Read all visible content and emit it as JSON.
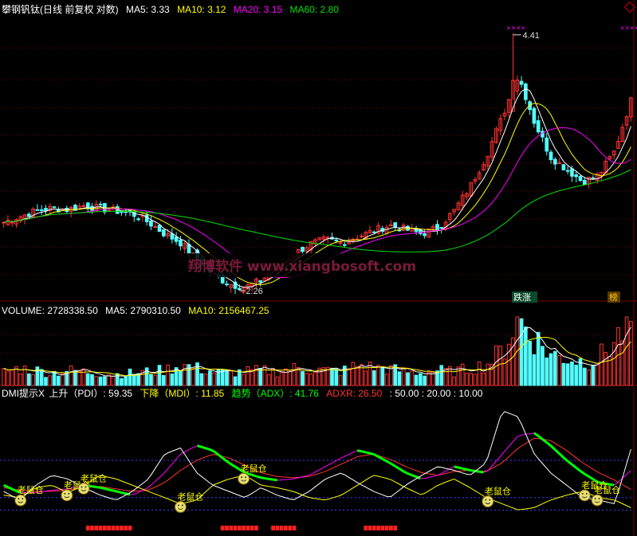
{
  "header": {
    "title": "攀钢钒钛(日线 前复权 对数)",
    "ma5": "MA5: 3.33",
    "ma10": "MA10: 3.12",
    "ma20": "MA20: 3.15",
    "ma60": "MA60: 2.80"
  },
  "volume_header": {
    "vol": "VOLUME: 2728338.50",
    "ma5": "MA5: 2790310.50",
    "ma10": "MA10: 2156467.25"
  },
  "dmi_header": {
    "name": "DMI提示X",
    "pdi": "上升（PDI）: 59.35",
    "mdi": "下降（MDI）: 11.85",
    "adx": "趋势（ADX）: 41.76",
    "adxr": "ADXR: 26.50",
    "levels": ": 50.00 : 20.00 : 10.00"
  },
  "annotations": {
    "high_label": "4.41",
    "low_label": "2.26",
    "tag_diezhang": "跌涨",
    "tag_bang": "榜",
    "watermark": "翔博软件 www.xiangbosoft.com",
    "mouse_label": "老鼠仓"
  },
  "colors": {
    "up": "#ff3232",
    "down": "#54fcfc",
    "ma5": "#ffffff",
    "ma10": "#ffff00",
    "ma20": "#ff00ff",
    "ma60": "#00e000",
    "pdi": "#ffffff",
    "mdi": "#ffff00",
    "adx_hi": "#00ff00",
    "adx_lo": "#ff00ff",
    "adxr": "#ff3232",
    "grid": "#7a0000"
  },
  "chart_data": {
    "type": "candlestick",
    "price_scale": "log",
    "ylim": [
      2.2,
      4.5
    ],
    "high": 4.41,
    "low": 2.26,
    "price_trend": [
      2.7,
      2.74,
      2.78,
      2.8,
      2.79,
      2.82,
      2.8,
      2.78,
      2.76,
      2.7,
      2.62,
      2.56,
      2.45,
      2.36,
      2.3,
      2.28,
      2.32,
      2.4,
      2.48,
      2.55,
      2.58,
      2.56,
      2.6,
      2.64,
      2.68,
      2.65,
      2.62,
      2.66,
      2.78,
      2.96,
      3.2,
      3.55,
      3.95,
      3.5,
      3.2,
      3.1,
      3.0,
      3.05,
      3.25,
      3.7
    ],
    "volume_trend": [
      0.2,
      0.25,
      0.22,
      0.18,
      0.22,
      0.2,
      0.18,
      0.16,
      0.18,
      0.2,
      0.22,
      0.3,
      0.25,
      0.2,
      0.18,
      0.2,
      0.22,
      0.2,
      0.25,
      0.24,
      0.22,
      0.2,
      0.3,
      0.26,
      0.24,
      0.2,
      0.18,
      0.22,
      0.2,
      0.25,
      0.3,
      0.5,
      1.0,
      0.7,
      0.45,
      0.4,
      0.35,
      0.4,
      0.65,
      0.95
    ],
    "pdi": [
      25,
      18,
      30,
      38,
      35,
      28,
      22,
      18,
      25,
      35,
      55,
      60,
      40,
      30,
      25,
      20,
      28,
      22,
      18,
      25,
      35,
      40,
      32,
      25,
      20,
      30,
      38,
      45,
      42,
      38,
      48,
      90,
      85,
      55,
      40,
      30,
      20,
      18,
      15,
      59
    ],
    "mdi": [
      22,
      20,
      28,
      30,
      24,
      30,
      38,
      35,
      30,
      25,
      20,
      15,
      18,
      30,
      35,
      38,
      30,
      28,
      25,
      20,
      18,
      22,
      30,
      38,
      35,
      28,
      22,
      30,
      35,
      28,
      20,
      15,
      10,
      12,
      18,
      22,
      25,
      20,
      18,
      11.85
    ],
    "adx": [
      30,
      24,
      24,
      26,
      27,
      30,
      28,
      25,
      22,
      28,
      40,
      55,
      62,
      58,
      48,
      40,
      36,
      34,
      35,
      38,
      45,
      52,
      58,
      55,
      48,
      40,
      35,
      38,
      45,
      42,
      40,
      55,
      70,
      72,
      62,
      50,
      40,
      32,
      30,
      41.76
    ],
    "adxr": [
      28,
      26,
      25,
      25,
      26,
      28,
      29,
      27,
      25,
      26,
      32,
      42,
      50,
      55,
      52,
      46,
      40,
      37,
      36,
      37,
      41,
      47,
      53,
      55,
      51,
      45,
      40,
      38,
      41,
      42,
      41,
      48,
      60,
      68,
      66,
      58,
      48,
      40,
      34,
      26.5
    ],
    "levels": [
      50,
      20,
      10
    ],
    "mouse_markers_x": [
      1,
      4,
      5,
      11,
      15,
      30,
      36,
      37
    ]
  }
}
